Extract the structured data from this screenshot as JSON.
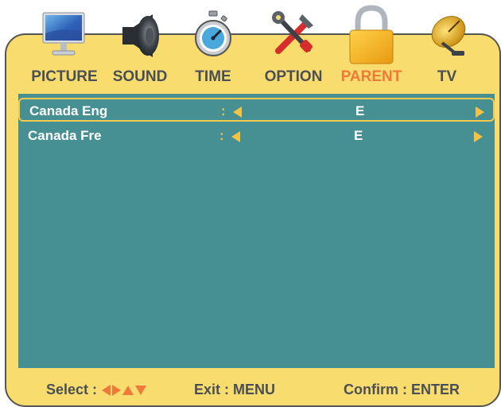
{
  "menu": {
    "tabs": [
      {
        "label": "PICTURE",
        "icon": "monitor-icon"
      },
      {
        "label": "SOUND",
        "icon": "speaker-icon"
      },
      {
        "label": "TIME",
        "icon": "stopwatch-icon"
      },
      {
        "label": "OPTION",
        "icon": "tools-icon"
      },
      {
        "label": "PARENT",
        "icon": "padlock-icon",
        "active": true
      },
      {
        "label": "TV",
        "icon": "satellite-dish-icon"
      }
    ]
  },
  "settings": {
    "rows": [
      {
        "label": "Canada Eng",
        "separator": ":",
        "value": "E",
        "selected": true
      },
      {
        "label": "Canada Fre",
        "separator": ":",
        "value": "E",
        "selected": false
      }
    ]
  },
  "footer": {
    "select_label": "Select :",
    "exit_label": "Exit : MENU",
    "confirm_label": "Confirm : ENTER"
  },
  "colors": {
    "frame": "#f8dc6e",
    "panel": "#468f93",
    "active_tab": "#f0793a",
    "accent": "#f5c242",
    "text_dark": "#4a4f55"
  }
}
